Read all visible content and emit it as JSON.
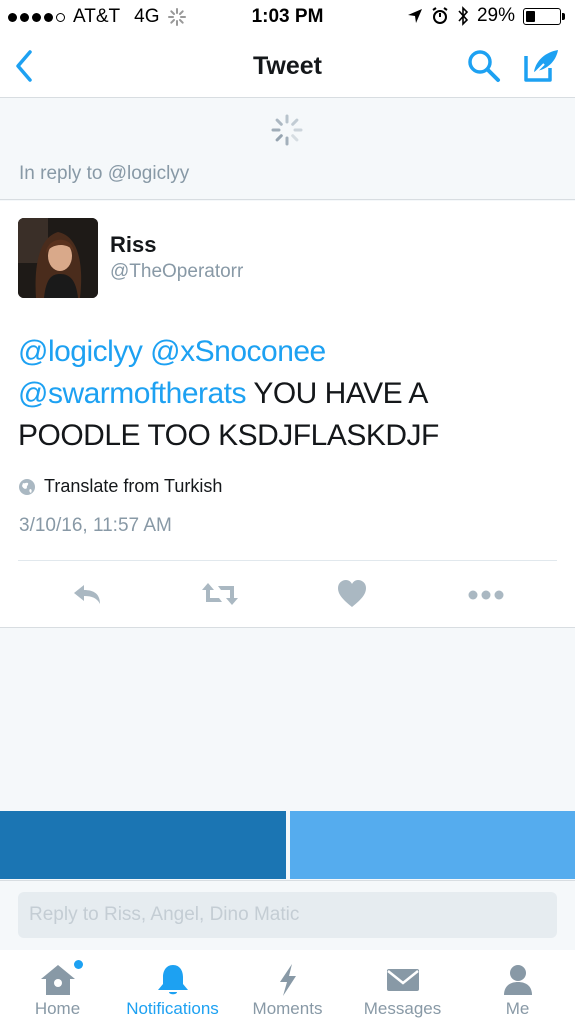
{
  "status_bar": {
    "carrier": "AT&T",
    "network": "4G",
    "time": "1:03 PM",
    "battery_percent_label": "29%",
    "battery_level": 0.29,
    "signal_bars_filled": 4,
    "signal_bars_total": 5
  },
  "nav": {
    "title": "Tweet",
    "back_icon": "chevron-left-icon",
    "search_icon": "search-icon",
    "compose_icon": "compose-icon"
  },
  "reply_context": {
    "text": "In reply to @logiclyy"
  },
  "tweet": {
    "author_name": "Riss",
    "author_handle": "@TheOperatorr",
    "mentions": [
      "@logiclyy",
      "@xSnoconee",
      "@swarmoftherats"
    ],
    "body_line_1_mention_1": "@logiclyy",
    "body_line_1_mention_2": "@xSnoconee",
    "body_line_2_mention": "@swarmoftherats",
    "body_text_1": " YOU HAVE A",
    "body_text_2": "POODLE TOO KSDJFLASKDJF",
    "translate_label": "Translate from Turkish",
    "timestamp": "3/10/16, 11:57 AM",
    "actions": [
      "reply-icon",
      "retweet-icon",
      "like-icon",
      "more-icon"
    ]
  },
  "reply_box": {
    "placeholder": "Reply to Riss, Angel, Dino Matic",
    "value": ""
  },
  "tabs": [
    {
      "label": "Home",
      "icon": "home-icon",
      "active": false,
      "has_dot": true
    },
    {
      "label": "Notifications",
      "icon": "bell-icon",
      "active": true,
      "has_dot": false
    },
    {
      "label": "Moments",
      "icon": "lightning-icon",
      "active": false,
      "has_dot": false
    },
    {
      "label": "Messages",
      "icon": "envelope-icon",
      "active": false,
      "has_dot": false
    },
    {
      "label": "Me",
      "icon": "person-icon",
      "active": false,
      "has_dot": false
    }
  ],
  "colors": {
    "accent": "#1da1f2",
    "text": "#14171a",
    "muted": "#8899a6",
    "background": "#f5f8fa",
    "split_left": "#1b75b3",
    "split_right": "#55acee"
  }
}
